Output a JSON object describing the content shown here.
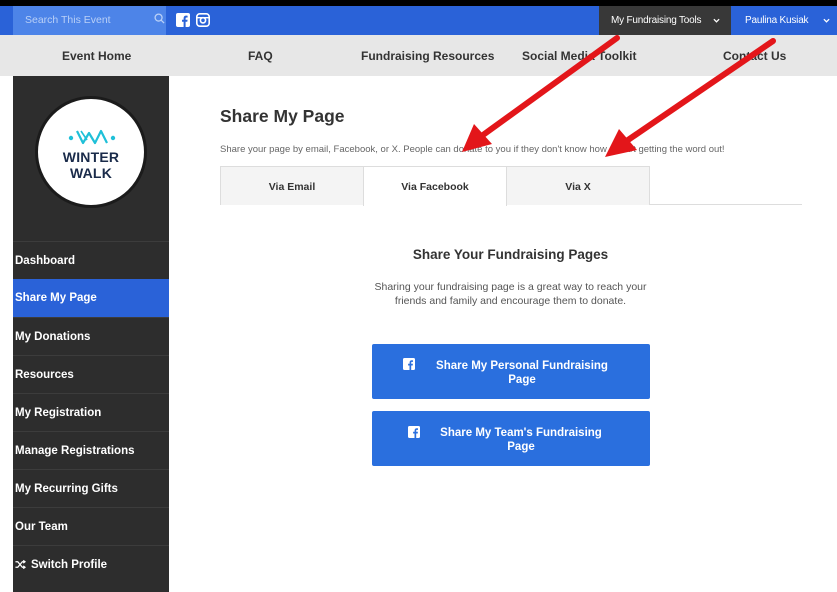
{
  "topbar": {
    "search_placeholder": "Search This Event",
    "search_icon": "search-icon",
    "social": [
      "facebook-icon",
      "instagram-icon"
    ],
    "tools_label": "My Fundraising Tools",
    "user_label": "Paulina Kusiak",
    "colors": {
      "bar": "#2a62d8",
      "tools_bg": "#383838"
    }
  },
  "subnav": {
    "items": [
      "Event Home",
      "FAQ",
      "Fundraising Resources",
      "Social Media Toolkit",
      "Contact Us"
    ]
  },
  "logo": {
    "line1": "WINTER",
    "line2": "WALK"
  },
  "sidebar": {
    "items": [
      {
        "label": "Dashboard"
      },
      {
        "label": "Share My Page"
      },
      {
        "label": "My Donations"
      },
      {
        "label": "Resources"
      },
      {
        "label": "My Registration"
      },
      {
        "label": "Manage Registrations"
      },
      {
        "label": "My Recurring Gifts"
      },
      {
        "label": "Our Team"
      },
      {
        "label": "Switch Profile"
      }
    ],
    "active_index": 1,
    "colors": {
      "bg": "#2d2d2d",
      "active": "#2a62d8"
    }
  },
  "main": {
    "title": "Share My Page",
    "description": "Share your page by email, Facebook, or X. People can donate to you if they don't know how – start getting the word out!",
    "tabs": [
      "Via Email",
      "Via Facebook",
      "Via X"
    ],
    "active_tab": 1,
    "share_title": "Share Your Fundraising Pages",
    "share_desc": "Sharing your fundraising page is a great way to reach your friends and family and encourage them to donate.",
    "buttons": {
      "personal_line1": "Share My Personal Fundraising",
      "personal_line2": "Page",
      "team_line1": "Share My Team's Fundraising",
      "team_line2": "Page"
    },
    "button_color": "#2a6fde"
  },
  "annotation": {
    "arrow_color": "#e3161a"
  }
}
